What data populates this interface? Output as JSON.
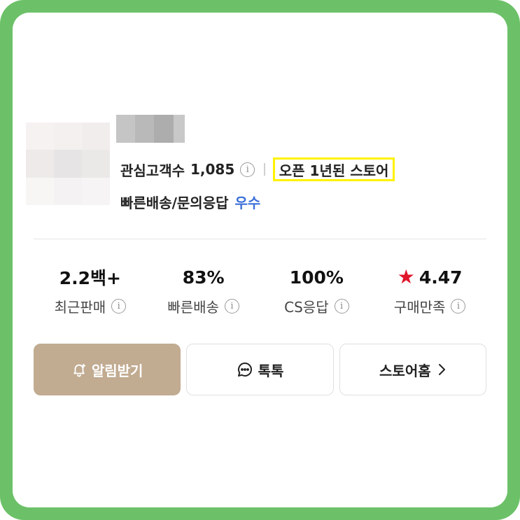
{
  "store": {
    "followers_label": "관심고객수",
    "followers_count": "1,085",
    "open_badge": "오픈 1년된 스토어",
    "service_label": "빠른배송/문의응답",
    "service_grade": "우수"
  },
  "stats": [
    {
      "value": "2.2백+",
      "label": "최근판매"
    },
    {
      "value": "83%",
      "label": "빠른배송"
    },
    {
      "value": "100%",
      "label": "CS응답"
    },
    {
      "value": "4.47",
      "label": "구매만족"
    }
  ],
  "buttons": {
    "notify": "알림받기",
    "talk": "톡톡",
    "store_home": "스토어홈"
  },
  "colors": {
    "frame": "#6cc168",
    "primary_button": "#c1ab91",
    "highlight": "#fff200",
    "grade": "#3d6fd9",
    "star": "#e0162b"
  },
  "icons": {
    "info": "info-icon",
    "star": "star-icon",
    "bell": "bell-icon",
    "chat": "chat-bubble-icon",
    "chevron": "chevron-right-icon"
  }
}
